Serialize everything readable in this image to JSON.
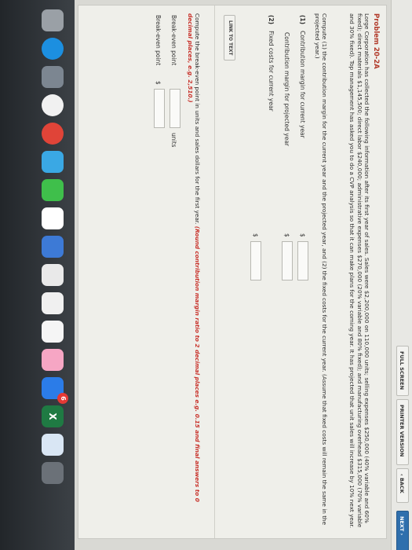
{
  "toolbar": {
    "full_screen": "FULL SCREEN",
    "printer_version": "PRINTER VERSION",
    "back": "‹ BACK",
    "next": "NEXT ›"
  },
  "problem": {
    "title": "Problem 20-2A",
    "intro": "Lorge Corporation has collected the following information after its first year of sales. Sales were $2,200,000 on 110,000 units; selling expenses $250,000 (40% variable and 60% fixed); direct materials $1,145,500; direct labor $240,000; administrative expenses $270,000 (20% variable and 80% fixed); and manufacturing overhead $315,000 (70% variable and 30% fixed). Top management has asked you to do a CVP analysis so that it can make plans for the coming year. It has projected that unit sales will increase by 10% next year."
  },
  "part1": {
    "instruction": "Compute (1) the contribution margin for the current year and the projected year, and (2) the fixed costs for the current year. (Assume that fixed costs will remain the same in the projected year.)",
    "item1_num": "(1)",
    "item1_label": "Contribution margin for current year",
    "item1b_label": "Contribution margin for projected year",
    "item2_num": "(2)",
    "item2_label": "Fixed costs for current year",
    "currency": "$"
  },
  "link_to_text": "LINK TO TEXT",
  "part2": {
    "instruction": "Compute the break-even point in units and sales dollars for the first year.",
    "note": "(Round contribution margin ratio to 2 decimal places e.g. 0.15 and final answers to 0 decimal places, e.g. 2,510.)",
    "units_label": "Break-even point",
    "units_suffix": "units",
    "dollars_label": "Break-even point",
    "currency": "$"
  },
  "dock": {
    "badge": "6",
    "excel_glyph": "X"
  },
  "colors": {
    "accent_red": "#c8312a",
    "title_red": "#b23a2a",
    "next_blue": "#2f6fad"
  }
}
